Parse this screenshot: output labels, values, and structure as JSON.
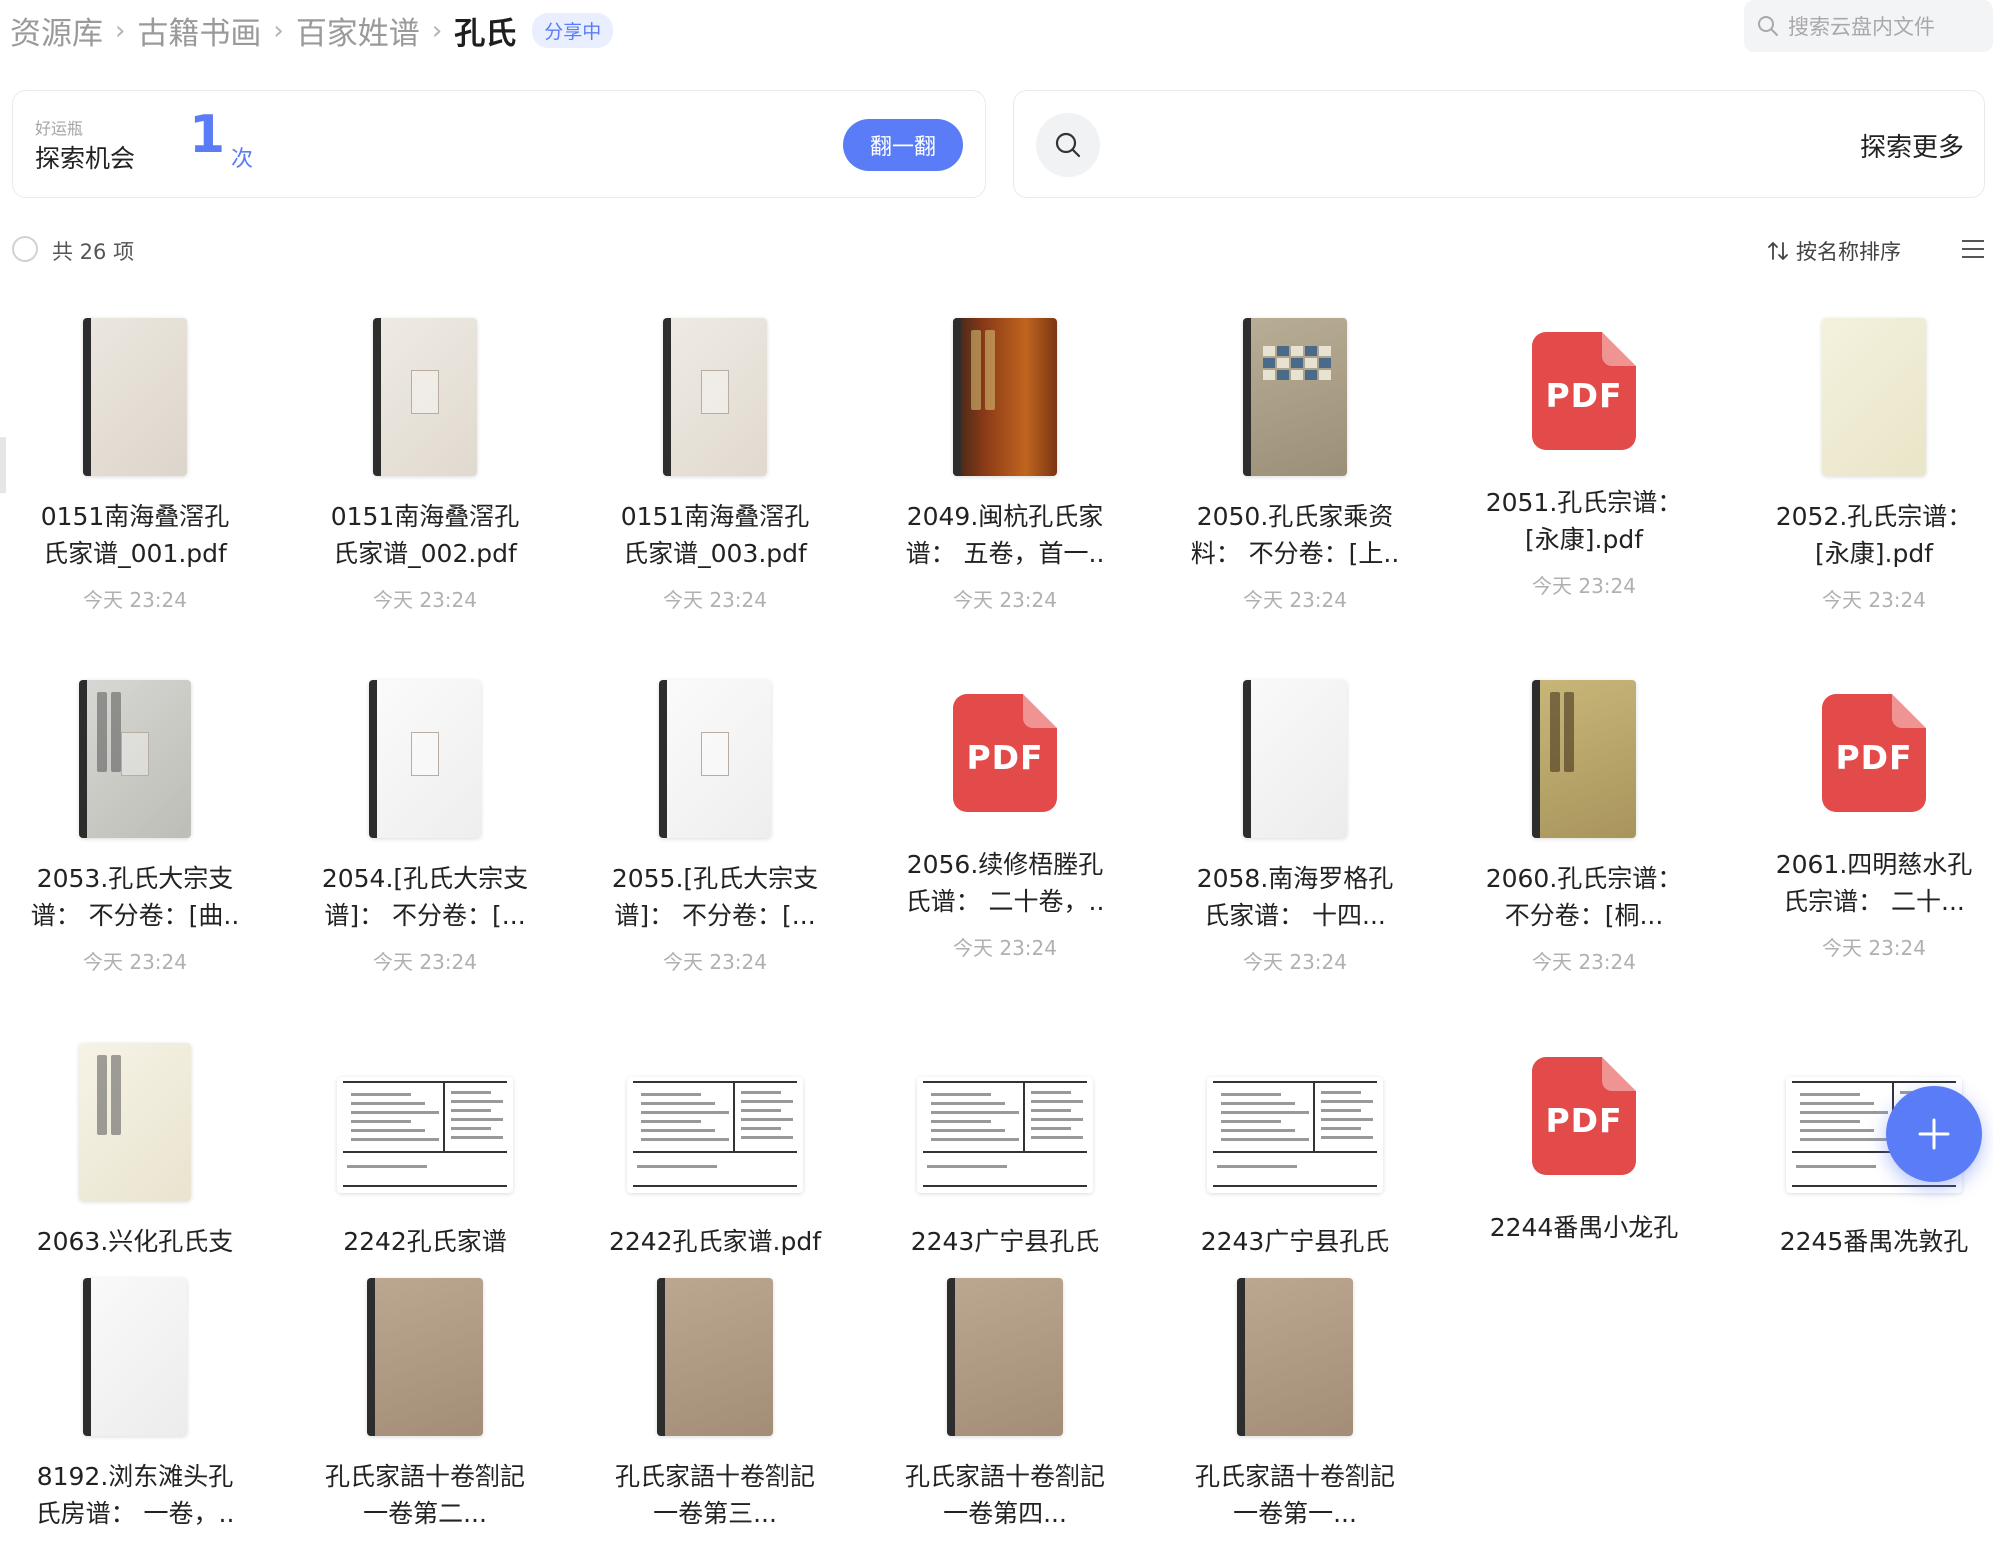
{
  "breadcrumb": {
    "items": [
      "资源库",
      "古籍书画",
      "百家姓谱"
    ],
    "current": "孔氏",
    "badge": "分享中"
  },
  "search": {
    "placeholder": "搜索云盘内文件",
    "icon": "search-icon"
  },
  "luck_card": {
    "small_label": "好运瓶",
    "title": "探索机会",
    "count": "1",
    "unit": "次",
    "button": "翻一翻"
  },
  "explore_card": {
    "label": "探索更多",
    "icon": "search-icon"
  },
  "list_header": {
    "count_text": "共 26 项",
    "sort_label": "按名称排序",
    "sort_icon": "sort-icon",
    "menu_icon": "menu-icon"
  },
  "colors": {
    "accent": "#5b7cf7",
    "pdf_red": "#e34a4a",
    "muted": "#b0b0b0"
  },
  "files": [
    {
      "line1": "0151南海叠滘孔",
      "line2": "氏家谱_001.pdf",
      "time": "今天 23:24",
      "thumb": "book-blank"
    },
    {
      "line1": "0151南海叠滘孔",
      "line2": "氏家谱_002.pdf",
      "time": "今天 23:24",
      "thumb": "book-seal"
    },
    {
      "line1": "0151南海叠滘孔",
      "line2": "氏家谱_003.pdf",
      "time": "今天 23:24",
      "thumb": "book-seal"
    },
    {
      "line1": "2049.闽杭孔氏家",
      "line2": "谱： 五卷，首一..",
      "time": "今天 23:24",
      "thumb": "book-red"
    },
    {
      "line1": "2050.孔氏家乘资",
      "line2": "料： 不分卷：[上..",
      "time": "今天 23:24",
      "thumb": "book-grid"
    },
    {
      "line1": "2051.孔氏宗谱：",
      "line2": "[永康].pdf",
      "time": "今天 23:24",
      "thumb": "pdf"
    },
    {
      "line1": "2052.孔氏宗谱：",
      "line2": "[永康].pdf",
      "time": "今天 23:24",
      "thumb": "book-cream"
    },
    {
      "line1": "2053.孔氏大宗支",
      "line2": "谱： 不分卷：[曲..",
      "time": "今天 23:24",
      "thumb": "book-grey"
    },
    {
      "line1": "2054.[孔氏大宗支",
      "line2": "谱]： 不分卷：[...",
      "time": "今天 23:24",
      "thumb": "book-white-seal"
    },
    {
      "line1": "2055.[孔氏大宗支",
      "line2": "谱]： 不分卷：[...",
      "time": "今天 23:24",
      "thumb": "book-white-seal"
    },
    {
      "line1": "2056.续修梧塍孔",
      "line2": "氏谱： 二十卷，..",
      "time": "今天 23:24",
      "thumb": "pdf"
    },
    {
      "line1": "2058.南海罗格孔",
      "line2": "氏家谱： 十四...",
      "time": "今天 23:24",
      "thumb": "book-white"
    },
    {
      "line1": "2060.孔氏宗谱：",
      "line2": "不分卷：[桐...",
      "time": "今天 23:24",
      "thumb": "book-gold"
    },
    {
      "line1": "2061.四明慈水孔",
      "line2": "氏宗谱： 二十...",
      "time": "今天 23:24",
      "thumb": "pdf"
    },
    {
      "line1": "2063.兴化孔氏支",
      "line2": "",
      "time": "",
      "thumb": "book-cream2"
    },
    {
      "line1": "2242孔氏家谱",
      "line2": "",
      "time": "",
      "thumb": "catalog"
    },
    {
      "line1": "2242孔氏家谱.pdf",
      "line2": "",
      "time": "",
      "thumb": "catalog"
    },
    {
      "line1": "2243广宁县孔氏",
      "line2": "",
      "time": "",
      "thumb": "catalog"
    },
    {
      "line1": "2243广宁县孔氏",
      "line2": "",
      "time": "",
      "thumb": "catalog"
    },
    {
      "line1": "2244番禺小龙孔",
      "line2": "",
      "time": "",
      "thumb": "pdf"
    },
    {
      "line1": "2245番禺冼敦孔",
      "line2": "",
      "time": "",
      "thumb": "catalog"
    },
    {
      "line1": "8192.浏东滩头孔",
      "line2": "氏房谱： 一卷，..",
      "time": "",
      "thumb": "book-white"
    },
    {
      "line1": "孔氏家語十卷劄記",
      "line2": "一卷第二...",
      "time": "",
      "thumb": "book-brown"
    },
    {
      "line1": "孔氏家語十卷劄記",
      "line2": "一卷第三...",
      "time": "",
      "thumb": "book-brown"
    },
    {
      "line1": "孔氏家語十卷劄記",
      "line2": "一卷第四...",
      "time": "",
      "thumb": "book-brown"
    },
    {
      "line1": "孔氏家語十卷劄記",
      "line2": "一卷第一...",
      "time": "",
      "thumb": "book-brown"
    }
  ],
  "fab": {
    "icon": "plus-icon"
  }
}
